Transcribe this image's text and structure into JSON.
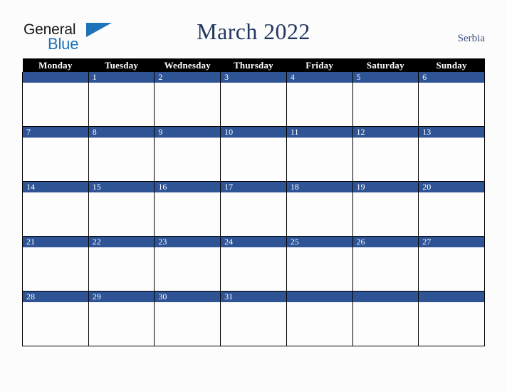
{
  "brand": {
    "name_part1": "General",
    "name_part2": "Blue",
    "triangle_icon": "triangle-icon",
    "colors": {
      "general_text": "#1a1a1a",
      "blue_text": "#1d72b8",
      "accent_blue": "#2f5496",
      "header_black": "#000000",
      "title_navy": "#22375f"
    }
  },
  "header": {
    "title": "March 2022",
    "country": "Serbia"
  },
  "calendar": {
    "weekday_headers": [
      "Monday",
      "Tuesday",
      "Wednesday",
      "Thursday",
      "Friday",
      "Saturday",
      "Sunday"
    ],
    "weeks": [
      [
        "",
        "1",
        "2",
        "3",
        "4",
        "5",
        "6"
      ],
      [
        "7",
        "8",
        "9",
        "10",
        "11",
        "12",
        "13"
      ],
      [
        "14",
        "15",
        "16",
        "17",
        "18",
        "19",
        "20"
      ],
      [
        "21",
        "22",
        "23",
        "24",
        "25",
        "26",
        "27"
      ],
      [
        "28",
        "29",
        "30",
        "31",
        "",
        "",
        ""
      ]
    ]
  }
}
